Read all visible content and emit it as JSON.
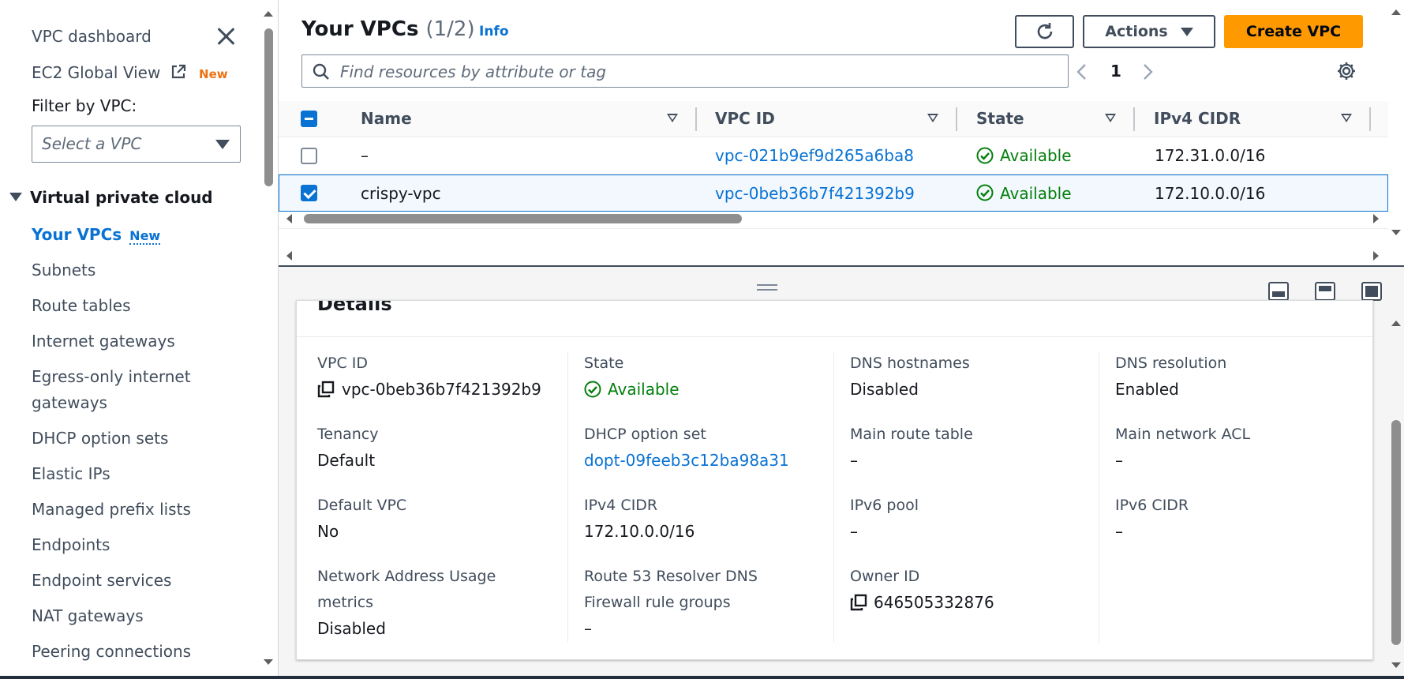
{
  "sidebar": {
    "dashboard": "VPC dashboard",
    "ec2_global_view": "EC2 Global View",
    "ec2_new_badge": "New",
    "filter_label": "Filter by VPC:",
    "filter_placeholder": "Select a VPC",
    "section_title": "Virtual private cloud",
    "active_item": "Your VPCs",
    "active_new": "New",
    "items": [
      "Subnets",
      "Route tables",
      "Internet gateways",
      "Egress-only internet",
      "gateways",
      "DHCP option sets",
      "Elastic IPs",
      "Managed prefix lists",
      "Endpoints",
      "Endpoint services",
      "NAT gateways",
      "Peering connections"
    ]
  },
  "header": {
    "title": "Your VPCs",
    "count": "(1/2)",
    "info": "Info",
    "actions_label": "Actions",
    "create_label": "Create VPC",
    "search_placeholder": "Find resources by attribute or tag",
    "page_number": "1"
  },
  "table": {
    "columns": [
      "Name",
      "VPC ID",
      "State",
      "IPv4 CIDR"
    ],
    "rows": [
      {
        "name": "–",
        "vpc_id": "vpc-021b9ef9d265a6ba8",
        "state": "Available",
        "ipv4_cidr": "172.31.0.0/16",
        "selected": false
      },
      {
        "name": "crispy-vpc",
        "vpc_id": "vpc-0beb36b7f421392b9",
        "state": "Available",
        "ipv4_cidr": "172.10.0.0/16",
        "selected": true
      }
    ]
  },
  "details": {
    "title": "Details",
    "fields": {
      "vpc_id_label": "VPC ID",
      "vpc_id_value": "vpc-0beb36b7f421392b9",
      "state_label": "State",
      "state_value": "Available",
      "dns_hostnames_label": "DNS hostnames",
      "dns_hostnames_value": "Disabled",
      "dns_resolution_label": "DNS resolution",
      "dns_resolution_value": "Enabled",
      "tenancy_label": "Tenancy",
      "tenancy_value": "Default",
      "dhcp_label": "DHCP option set",
      "dhcp_value": "dopt-09feeb3c12ba98a31",
      "main_route_label": "Main route table",
      "main_route_value": "–",
      "main_acl_label": "Main network ACL",
      "main_acl_value": "–",
      "default_vpc_label": "Default VPC",
      "default_vpc_value": "No",
      "ipv4_label": "IPv4 CIDR",
      "ipv4_value": "172.10.0.0/16",
      "ipv6_pool_label": "IPv6 pool",
      "ipv6_pool_value": "–",
      "ipv6_cidr_label": "IPv6 CIDR",
      "ipv6_cidr_value": "–",
      "nau_label_1": "Network Address Usage",
      "nau_label_2": "metrics",
      "nau_value": "Disabled",
      "r53_label_1": "Route 53 Resolver DNS",
      "r53_label_2": "Firewall rule groups",
      "r53_value": "–",
      "owner_label": "Owner ID",
      "owner_value": "646505332876"
    }
  },
  "colors": {
    "primary_blue": "#0972d3",
    "success_green": "#037f0c",
    "orange_button": "#ff9900",
    "new_badge": "#ec7211"
  }
}
